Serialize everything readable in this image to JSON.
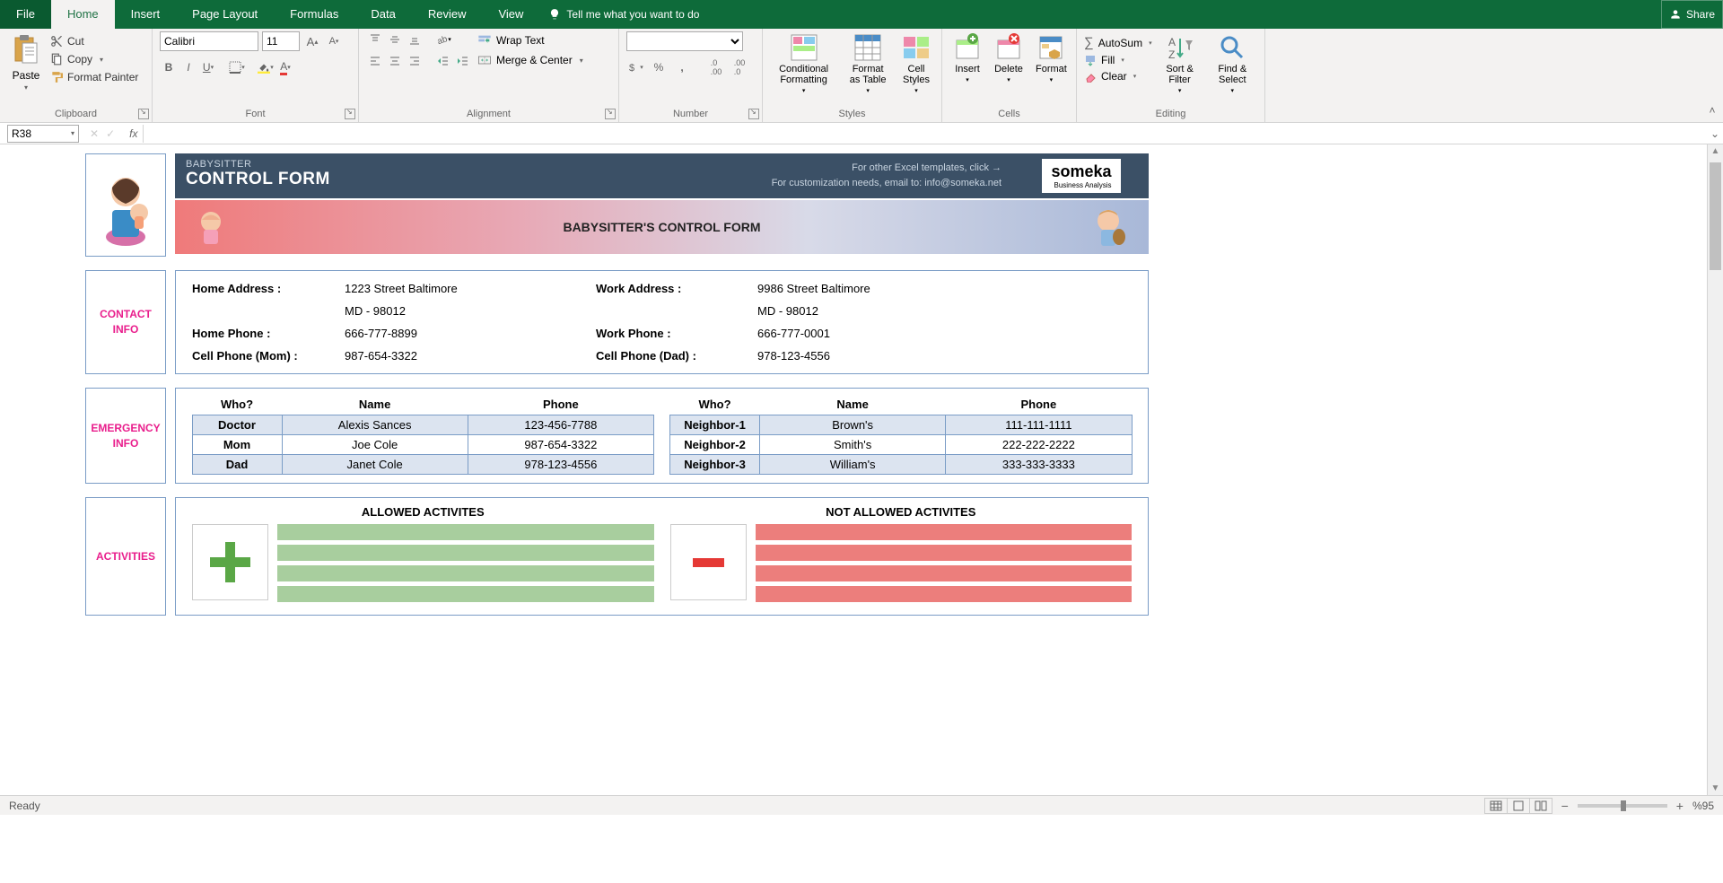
{
  "titlebar": {
    "share": "Share"
  },
  "tabs": {
    "file": "File",
    "home": "Home",
    "insert": "Insert",
    "pageLayout": "Page Layout",
    "formulas": "Formulas",
    "data": "Data",
    "review": "Review",
    "view": "View",
    "tellMe": "Tell me what you want to do"
  },
  "ribbon": {
    "clipboard": {
      "label": "Clipboard",
      "paste": "Paste",
      "cut": "Cut",
      "copy": "Copy",
      "formatPainter": "Format Painter"
    },
    "font": {
      "label": "Font",
      "name": "Calibri",
      "size": "11"
    },
    "alignment": {
      "label": "Alignment",
      "wrap": "Wrap Text",
      "merge": "Merge & Center"
    },
    "number": {
      "label": "Number"
    },
    "styles": {
      "label": "Styles",
      "cond": "Conditional Formatting",
      "fmtTable": "Format as Table",
      "cellStyles": "Cell Styles"
    },
    "cells": {
      "label": "Cells",
      "insert": "Insert",
      "delete": "Delete",
      "format": "Format"
    },
    "editing": {
      "label": "Editing",
      "autosum": "AutoSum",
      "fill": "Fill",
      "clear": "Clear",
      "sort": "Sort & Filter",
      "find": "Find & Select"
    }
  },
  "nameBox": "R38",
  "template": {
    "headerSub": "BABYSITTER",
    "headerMain": "CONTROL FORM",
    "headerNote1": "For other Excel templates, click →",
    "headerNote2": "For customization needs, email to: info@someka.net",
    "logo": "someka",
    "logoSub": "Business Analysis",
    "bannerTitle": "BABYSITTER'S CONTROL FORM",
    "sections": {
      "contact": "CONTACT INFO",
      "emergency": "EMERGENCY INFO",
      "activities": "ACTIVITIES"
    },
    "contact": {
      "homeAddrLbl": "Home Address :",
      "homeAddr1": "1223 Street Baltimore",
      "homeAddr2": "MD - 98012",
      "workAddrLbl": "Work Address :",
      "workAddr1": "9986 Street Baltimore",
      "workAddr2": "MD - 98012",
      "homePhoneLbl": "Home Phone :",
      "homePhone": "666-777-8899",
      "workPhoneLbl": "Work Phone :",
      "workPhone": "666-777-0001",
      "cellMomLbl": "Cell Phone (Mom) :",
      "cellMom": "987-654-3322",
      "cellDadLbl": "Cell Phone (Dad) :",
      "cellDad": "978-123-4556"
    },
    "emergency": {
      "headers": {
        "who": "Who?",
        "name": "Name",
        "phone": "Phone"
      },
      "left": [
        {
          "who": "Doctor",
          "name": "Alexis Sances",
          "phone": "123-456-7788"
        },
        {
          "who": "Mom",
          "name": "Joe Cole",
          "phone": "987-654-3322"
        },
        {
          "who": "Dad",
          "name": "Janet Cole",
          "phone": "978-123-4556"
        }
      ],
      "right": [
        {
          "who": "Neighbor-1",
          "name": "Brown's",
          "phone": "111-111-1111"
        },
        {
          "who": "Neighbor-2",
          "name": "Smith's",
          "phone": "222-222-2222"
        },
        {
          "who": "Neighbor-3",
          "name": "William's",
          "phone": "333-333-3333"
        }
      ]
    },
    "activities": {
      "allowed": "ALLOWED ACTIVITES",
      "notAllowed": "NOT ALLOWED ACTIVITES"
    }
  },
  "statusbar": {
    "ready": "Ready",
    "zoom": "%95"
  }
}
